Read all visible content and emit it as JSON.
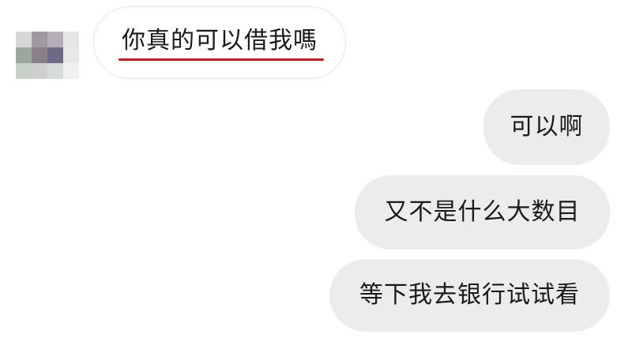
{
  "conversation": {
    "incoming": {
      "text": "你真的可以借我嗎",
      "underline_color": "#d9141b"
    },
    "outgoing": [
      {
        "text": "可以啊"
      },
      {
        "text": "又不是什么大数目"
      },
      {
        "text": "等下我去银行试试看"
      }
    ]
  },
  "colors": {
    "incoming_bubble": "#ffffff",
    "incoming_border": "#e4e4e4",
    "outgoing_bubble": "#ececec",
    "text": "#1a1a1a"
  },
  "avatar": {
    "icon": "pixelated-avatar-icon",
    "pixels": [
      "#d8d6d8",
      "#a09aa0",
      "#b4aeb6",
      "#e6e4e6",
      "#9aa89c",
      "#8a8088",
      "#6e6a86",
      "#e8e6e8",
      "#c6d0c8",
      "#cfcfcf",
      "#d8dcd8",
      "#f0f0f0"
    ]
  }
}
